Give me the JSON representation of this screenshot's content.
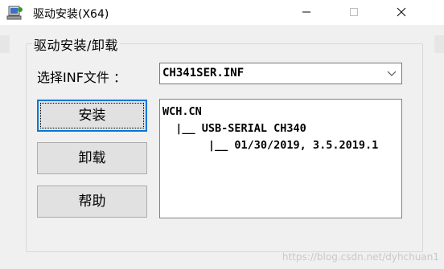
{
  "window": {
    "title": "驱动安装(X64)",
    "icon": "installer-icon"
  },
  "group": {
    "title": "驱动安装/卸载"
  },
  "inf": {
    "label": "选择INF文件 ：",
    "selected": "CH341SER.INF"
  },
  "buttons": {
    "install": "安装",
    "uninstall": "卸载",
    "help": "帮助"
  },
  "info": {
    "line1": "WCH.CN",
    "line2": "  |__ USB-SERIAL CH340",
    "line3": "       |__ 01/30/2019, 3.5.2019.1"
  },
  "watermark": "https://blog.csdn.net/dyhchuan1",
  "colors": {
    "accent": "#0078d7",
    "window_bg": "#f0f0f0"
  }
}
